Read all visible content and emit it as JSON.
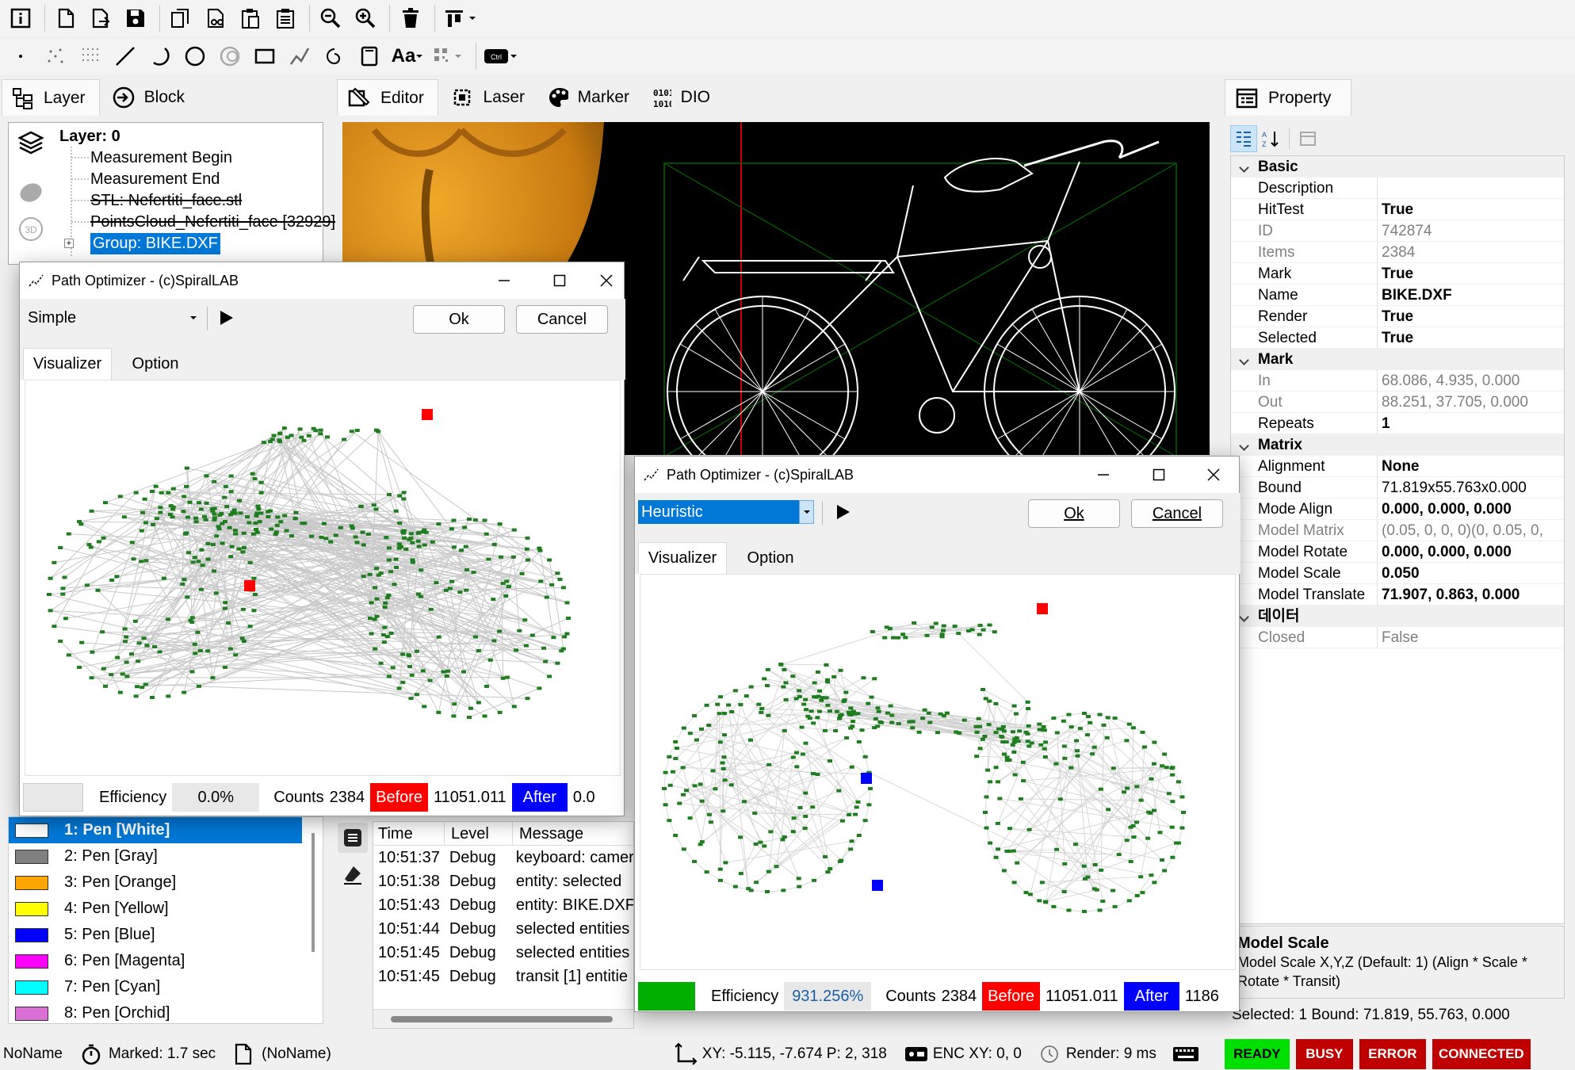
{
  "toolbar1": {
    "icons": [
      "info-icon",
      "new-file-icon",
      "new-file-arrow-icon",
      "save-icon",
      "copy-icon",
      "cut-icon",
      "paste-icon",
      "clipboard-icon",
      "zoom-out-icon",
      "zoom-in-icon",
      "delete-icon",
      "align-icon"
    ]
  },
  "toolbar2": {
    "font_label": "Aa",
    "ctrl_label": "Ctrl"
  },
  "left_tabs": {
    "layer": "Layer",
    "block": "Block"
  },
  "center_tabs": {
    "editor": "Editor",
    "laser": "Laser",
    "marker": "Marker",
    "dio": "DIO"
  },
  "right_tabs": {
    "property": "Property"
  },
  "tree": {
    "root": "Layer: 0",
    "items": [
      "Measurement Begin",
      "Measurement End",
      "STL: Nefertiti_face.stl",
      "PointsCloud_Nefertiti_face [32929]",
      "Group: BIKE.DXF"
    ]
  },
  "pens": [
    {
      "label": "1: Pen [White]",
      "color": "#ffffff"
    },
    {
      "label": "2: Pen [Gray]",
      "color": "#808080"
    },
    {
      "label": "3: Pen [Orange]",
      "color": "#ffa500"
    },
    {
      "label": "4: Pen [Yellow]",
      "color": "#ffff00"
    },
    {
      "label": "5: Pen [Blue]",
      "color": "#0000ff"
    },
    {
      "label": "6: Pen [Magenta]",
      "color": "#ff00ff"
    },
    {
      "label": "7: Pen [Cyan]",
      "color": "#00ffff"
    },
    {
      "label": "8: Pen [Orchid]",
      "color": "#da70d6"
    }
  ],
  "log": {
    "headers": {
      "time": "Time",
      "level": "Level",
      "message": "Message"
    },
    "rows": [
      {
        "time": "10:51:37",
        "level": "Debug",
        "message": "keyboard: camer"
      },
      {
        "time": "10:51:38",
        "level": "Debug",
        "message": "entity: selected"
      },
      {
        "time": "10:51:43",
        "level": "Debug",
        "message": "entity: BIKE.DXF"
      },
      {
        "time": "10:51:44",
        "level": "Debug",
        "message": "selected entities"
      },
      {
        "time": "10:51:45",
        "level": "Debug",
        "message": "selected entities"
      },
      {
        "time": "10:51:45",
        "level": "Debug",
        "message": "transit [1] entitie"
      }
    ]
  },
  "property": {
    "basic": {
      "title": "Basic",
      "rows": [
        {
          "k": "Description",
          "v": "",
          "style": "b"
        },
        {
          "k": "HitTest",
          "v": "True",
          "style": "b"
        },
        {
          "k": "ID",
          "v": "742874",
          "style": "g"
        },
        {
          "k": "Items",
          "v": "2384",
          "style": "g"
        },
        {
          "k": "Mark",
          "v": "True",
          "style": "b"
        },
        {
          "k": "Name",
          "v": "BIKE.DXF",
          "style": "b"
        },
        {
          "k": "Render",
          "v": "True",
          "style": "b"
        },
        {
          "k": "Selected",
          "v": "True",
          "style": "b"
        }
      ]
    },
    "mark": {
      "title": "Mark",
      "rows": [
        {
          "k": "In",
          "v": "68.086, 4.935, 0.000",
          "style": "g"
        },
        {
          "k": "Out",
          "v": "88.251, 37.705, 0.000",
          "style": "g"
        },
        {
          "k": "Repeats",
          "v": "1",
          "style": "b"
        }
      ]
    },
    "matrix": {
      "title": "Matrix",
      "rows": [
        {
          "k": "Alignment",
          "v": "None",
          "style": "b"
        },
        {
          "k": "Bound",
          "v": "71.819x55.763x0.000",
          "style": "n"
        },
        {
          "k": "Mode Align",
          "v": "0.000, 0.000, 0.000",
          "style": "b"
        },
        {
          "k": "Model Matrix",
          "v": "(0.05, 0, 0, 0)(0, 0.05, 0,",
          "style": "g"
        },
        {
          "k": "Model Rotate",
          "v": "0.000, 0.000, 0.000",
          "style": "b"
        },
        {
          "k": "Model Scale",
          "v": "0.050",
          "style": "b"
        },
        {
          "k": "Model Translate",
          "v": "71.907, 0.863, 0.000",
          "style": "b"
        }
      ]
    },
    "data": {
      "title": "데이터",
      "rows": [
        {
          "k": "Closed",
          "v": "False",
          "style": "g"
        }
      ]
    },
    "help_title": "Model Scale",
    "help_text": "Model Scale X,Y,Z (Default: 1) (Align * Scale * Rotate * Transit)",
    "selected": "Selected: 1  Bound: 71.819, 55.763, 0.000"
  },
  "dialog1": {
    "title": "Path Optimizer - (c)SpiralLAB",
    "mode": "Simple",
    "ok": "Ok",
    "cancel": "Cancel",
    "tab_vis": "Visualizer",
    "tab_opt": "Option",
    "efficiency_label": "Efficiency",
    "efficiency": "0.0%",
    "counts_label": "Counts",
    "counts": "2384",
    "before_label": "Before",
    "before": "11051.011",
    "after_label": "After",
    "after": "0.0"
  },
  "dialog2": {
    "title": "Path Optimizer - (c)SpiralLAB",
    "mode": "Heuristic",
    "ok": "Ok",
    "cancel": "Cancel",
    "tab_vis": "Visualizer",
    "tab_opt": "Option",
    "efficiency_label": "Efficiency",
    "efficiency": "931.256%",
    "counts_label": "Counts",
    "counts": "2384",
    "before_label": "Before",
    "before": "11051.011",
    "after_label": "After",
    "after": "1186"
  },
  "statusbar": {
    "name": "NoName",
    "marked": "Marked: 1.7 sec",
    "doc": "(NoName)",
    "xy": "XY: -5.115, -7.674  P: 2, 318",
    "enc": "ENC XY: 0, 0",
    "render": "Render: 9 ms",
    "ready": "READY",
    "busy": "BUSY",
    "error": "ERROR",
    "connected": "CONNECTED"
  },
  "colors": {
    "ready": "#00e000",
    "busy": "#c00000",
    "error": "#c00000",
    "connected": "#c00000",
    "before": "#ff0000",
    "after": "#0000ff",
    "path": "#1e7d1e",
    "selection": "#0078d7"
  }
}
